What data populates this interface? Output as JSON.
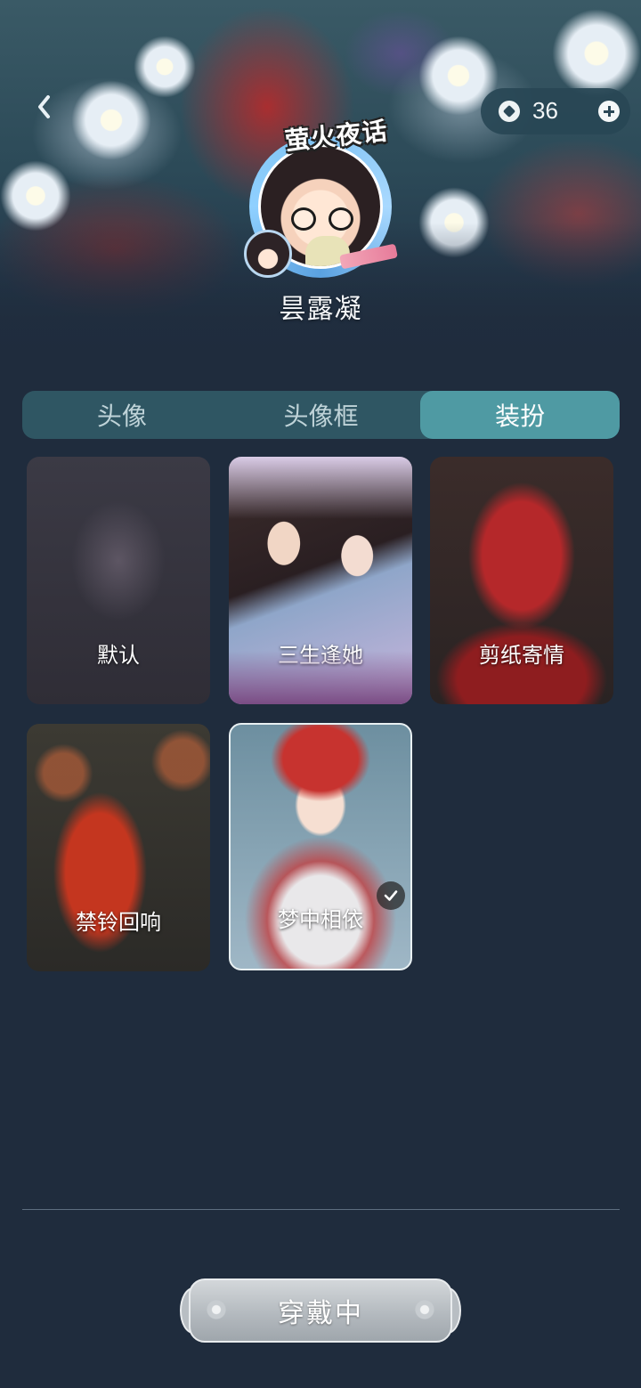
{
  "header": {
    "coins": "36",
    "avatar_logo_text": "萤火夜话",
    "username": "昙露凝"
  },
  "tabs": [
    {
      "label": "头像",
      "active": false
    },
    {
      "label": "头像框",
      "active": false
    },
    {
      "label": "装扮",
      "active": true
    }
  ],
  "outfits": [
    {
      "label": "默认",
      "selected": false
    },
    {
      "label": "三生逢她",
      "selected": false
    },
    {
      "label": "剪纸寄情",
      "selected": false
    },
    {
      "label": "禁铃回响",
      "selected": false
    },
    {
      "label": "梦中相依",
      "selected": true
    }
  ],
  "footer": {
    "wear_button_label": "穿戴中"
  },
  "icons": {
    "back": "chevron-left-icon",
    "coin": "coin-icon",
    "add": "plus-icon",
    "selected": "checkmark-icon"
  },
  "colors": {
    "background": "#1f2c3d",
    "tab_bar": "#2f5663",
    "tab_active": "#4f9aa3"
  }
}
